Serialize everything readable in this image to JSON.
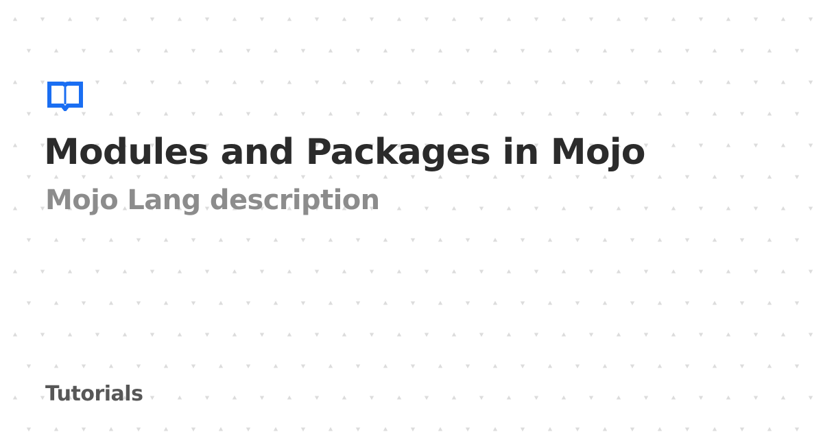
{
  "card": {
    "title": "Modules and Packages in Mojo",
    "subtitle": "Mojo Lang description",
    "category": "Tutorials",
    "logo_icon": "book-open-icon"
  },
  "colors": {
    "background": "#ffffff",
    "accent": "#1a6ef2",
    "title": "#2b2b2b",
    "subtitle": "#8c8c8c",
    "category": "#575757",
    "pattern": "#dcdcdc"
  }
}
